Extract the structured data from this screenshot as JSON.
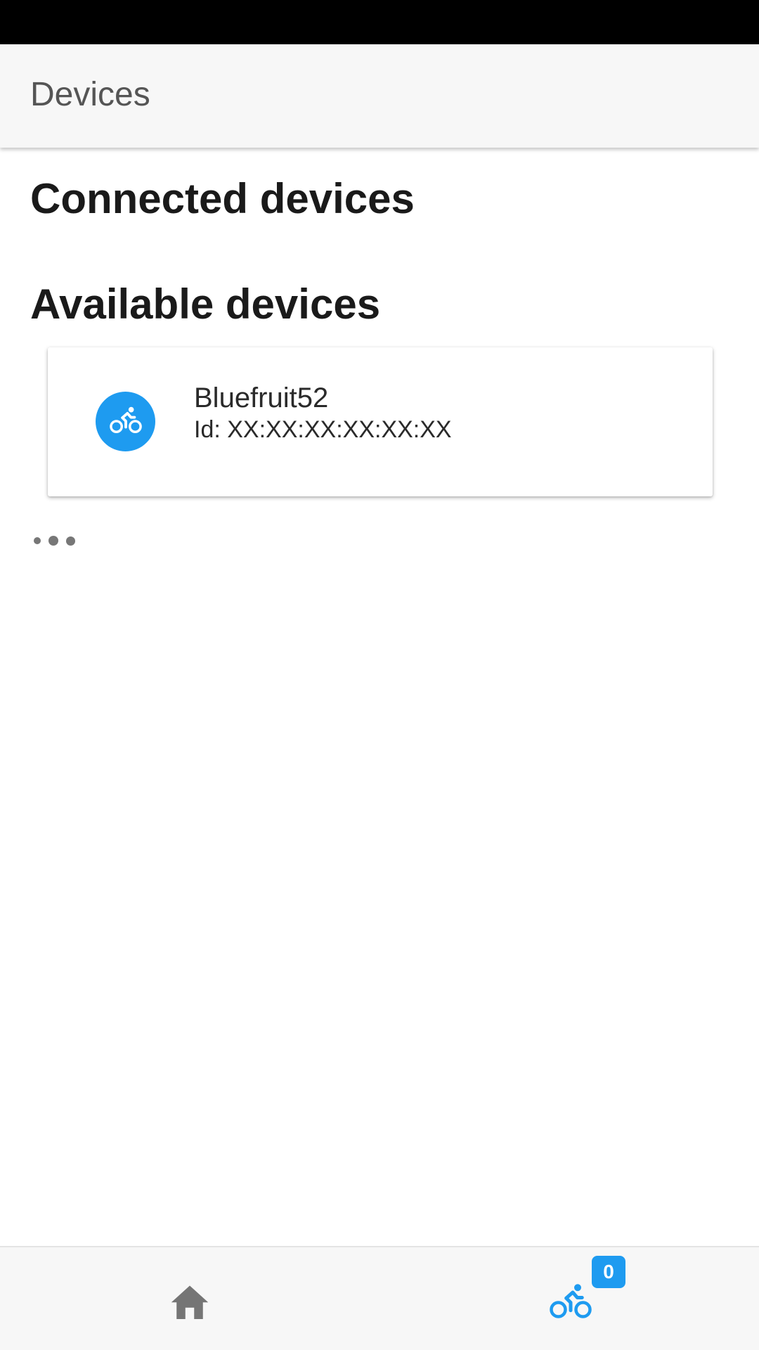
{
  "app_bar": {
    "title": "Devices"
  },
  "sections": {
    "connected_heading": "Connected devices",
    "available_heading": "Available devices"
  },
  "available_devices": [
    {
      "name": "Bluefruit52",
      "id_text": "Id: XX:XX:XX:XX:XX:XX",
      "icon": "bike-icon"
    }
  ],
  "bottom_nav": {
    "home_icon": "home-icon",
    "devices_icon": "bike-icon",
    "devices_badge": "0"
  },
  "colors": {
    "accent": "#1e9bf0",
    "app_bar_bg": "#f7f7f7",
    "nav_icon_inactive": "#757575",
    "status_bar": "#000000"
  }
}
